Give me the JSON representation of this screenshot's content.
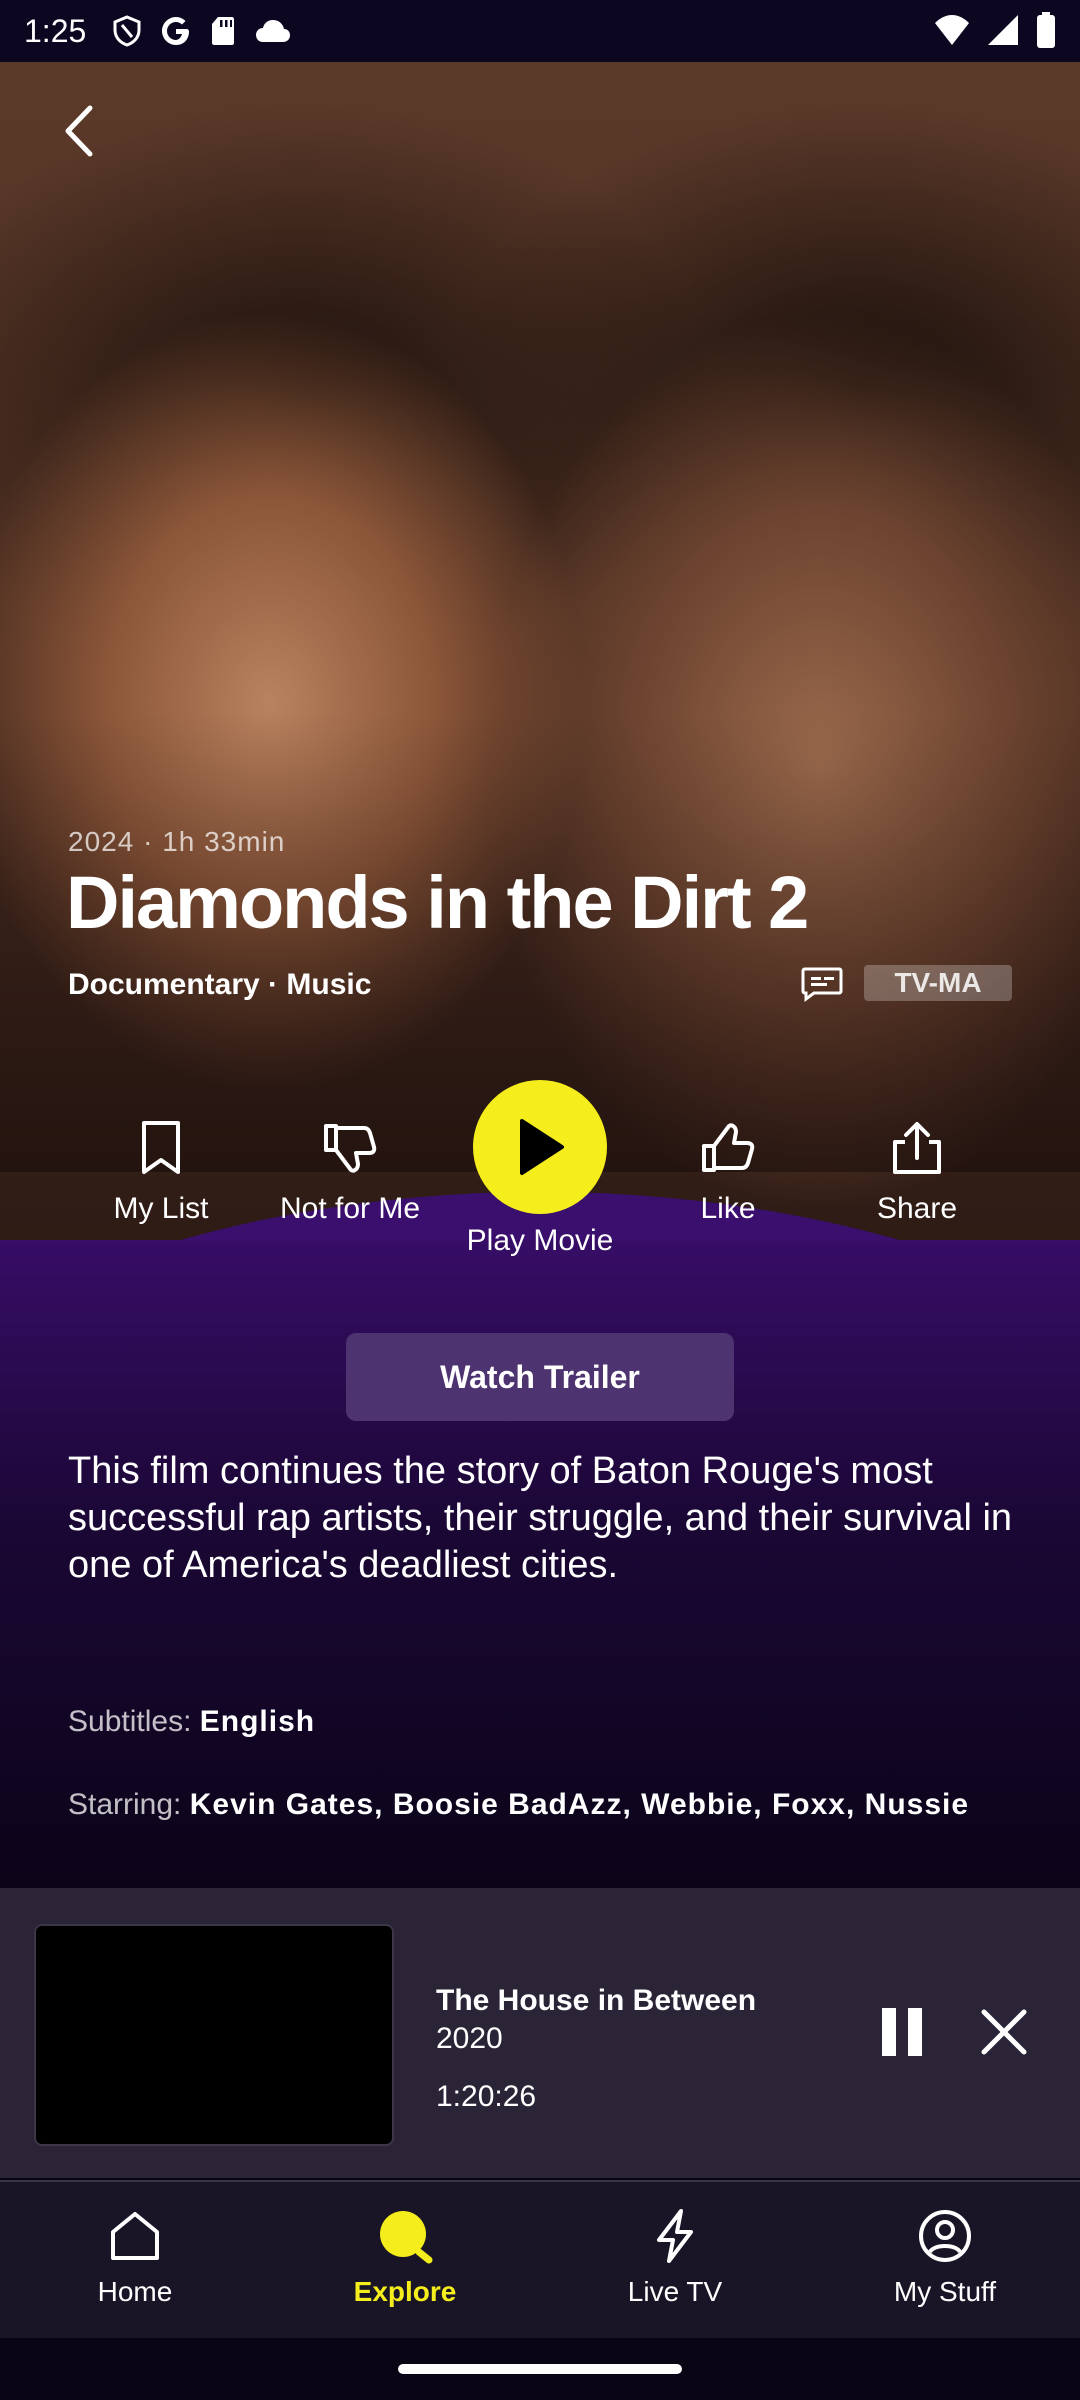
{
  "status_bar": {
    "time": "1:25"
  },
  "movie": {
    "year": "2024",
    "duration": "1h 33min",
    "meta_separator": " · ",
    "title": "Diamonds in the Dirt 2",
    "genres": "Documentary · Music",
    "rating": "TV-MA",
    "description": "This film continues the story of Baton Rouge's most successful rap artists, their struggle, and their survival in one of America's deadliest cities.",
    "subtitles_label": "Subtitles:",
    "subtitles_value": "English",
    "starring_label": "Starring:",
    "starring_value": "Kevin Gates, Boosie BadAzz, Webbie, Foxx, Nussie"
  },
  "actions": {
    "my_list": "My List",
    "not_for_me": "Not for Me",
    "play": "Play Movie",
    "like": "Like",
    "share": "Share",
    "trailer": "Watch Trailer"
  },
  "mini_player": {
    "title": "The House in Between",
    "year": "2020",
    "time": "1:20:26"
  },
  "tabs": [
    {
      "label": "Home",
      "icon": "home-icon"
    },
    {
      "label": "Explore",
      "icon": "explore-icon",
      "active": true
    },
    {
      "label": "Live TV",
      "icon": "lightning-icon"
    },
    {
      "label": "My Stuff",
      "icon": "profile-icon"
    }
  ],
  "colors": {
    "accent": "#f5ed1c",
    "purple": "#3a0f6e",
    "trailer_bg": "#4d3470"
  }
}
